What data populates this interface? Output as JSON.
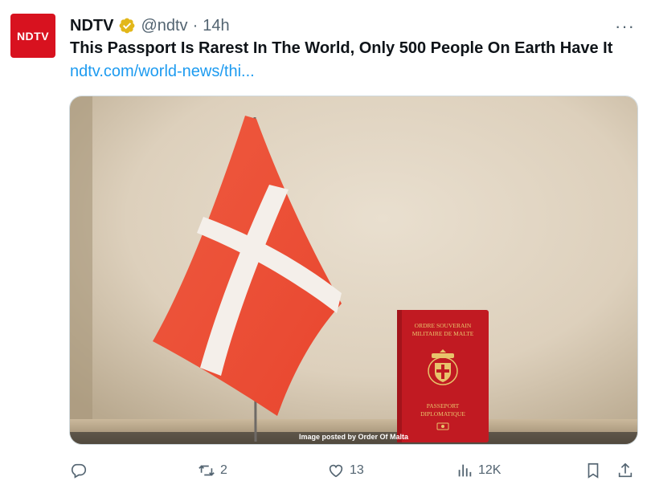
{
  "tweet": {
    "avatar_text": "NDTV",
    "name": "NDTV",
    "handle": "@ndtv",
    "separator": "·",
    "time": "14h",
    "title": "This Passport Is Rarest In The World, Only 500 People On Earth Have It",
    "link": "ndtv.com/world-news/thi..."
  },
  "media": {
    "caption": "Image posted by Order Of Malta",
    "passport_top_line1": "ORDRE SOUVERAIN",
    "passport_top_line2": "MILITAIRE DE MALTE",
    "passport_bottom_line1": "PASSEPORT",
    "passport_bottom_line2": "DIPLOMATIQUE"
  },
  "actions": {
    "reply_count": "",
    "retweet_count": "2",
    "like_count": "13",
    "views_count": "12K"
  },
  "colors": {
    "accent": "#1d9bf0",
    "verified": "#e2b719",
    "brand": "#d8121f",
    "muted": "#536471"
  }
}
